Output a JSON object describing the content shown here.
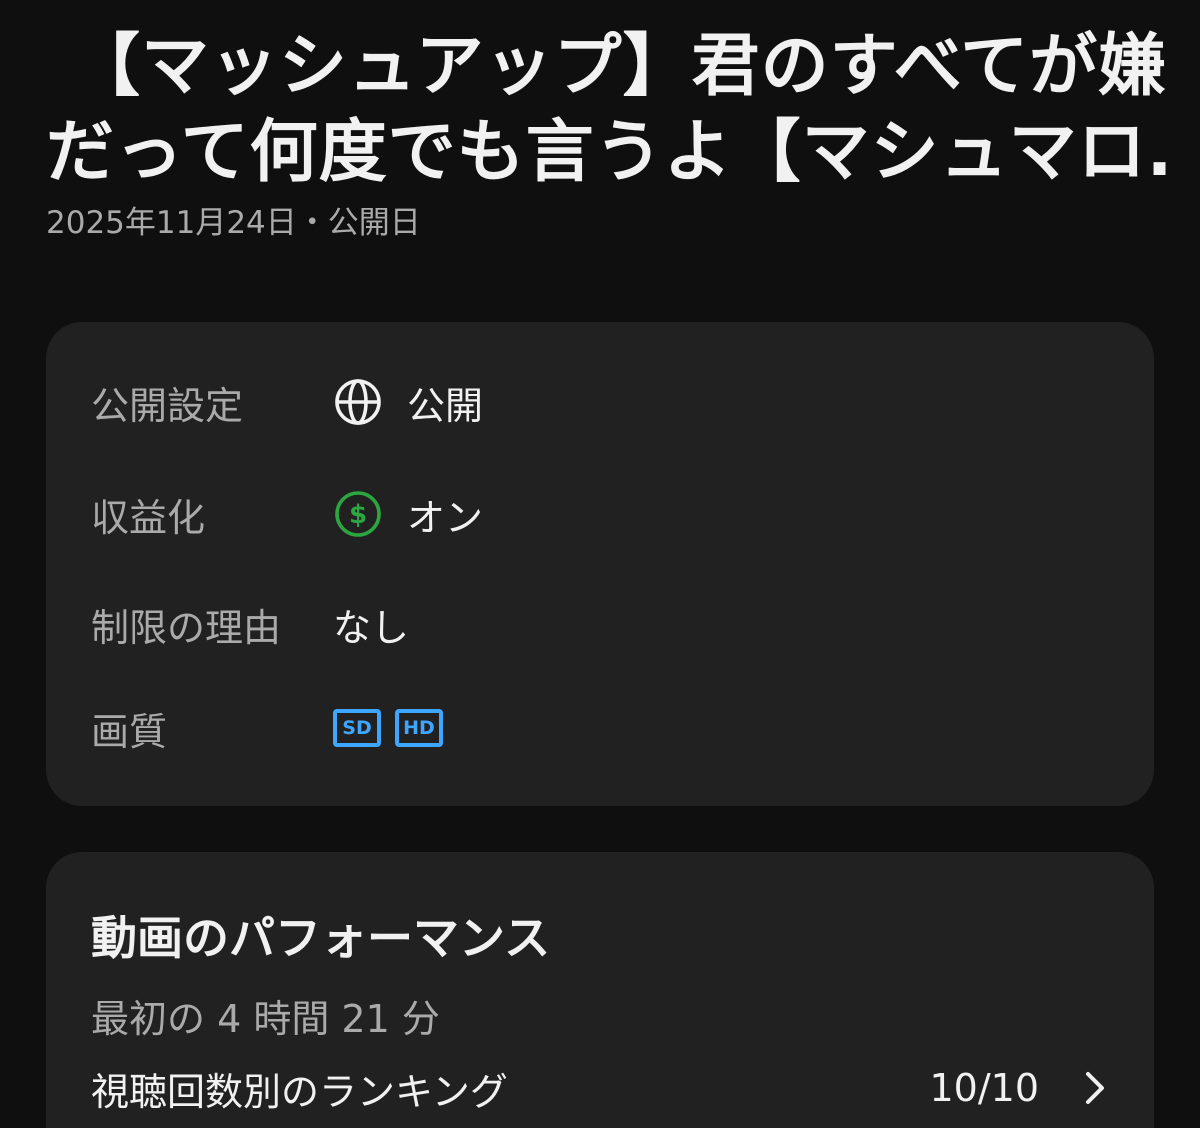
{
  "video": {
    "title_line1": "【マッシュアップ】君のすべてが嫌",
    "title_line2": "だって何度でも言うよ【マシュマロ..",
    "publish_date": "2025年11月24日・公開日"
  },
  "details": {
    "visibility": {
      "label": "公開設定",
      "value": "公開",
      "icon": "globe-icon"
    },
    "monetization": {
      "label": "収益化",
      "value": "オン",
      "icon": "dollar-icon",
      "icon_color": "#2ba640"
    },
    "restrictions": {
      "label": "制限の理由",
      "value": "なし"
    },
    "quality": {
      "label": "画質",
      "badges": [
        "SD",
        "HD"
      ],
      "badge_color": "#3ea6ff"
    }
  },
  "performance": {
    "title": "動画のパフォーマンス",
    "subtitle": "最初の 4 時間 21 分",
    "ranking_label": "視聴回数別のランキング",
    "ranking_value": "10/10",
    "chevron_icon": "chevron-right-icon"
  }
}
